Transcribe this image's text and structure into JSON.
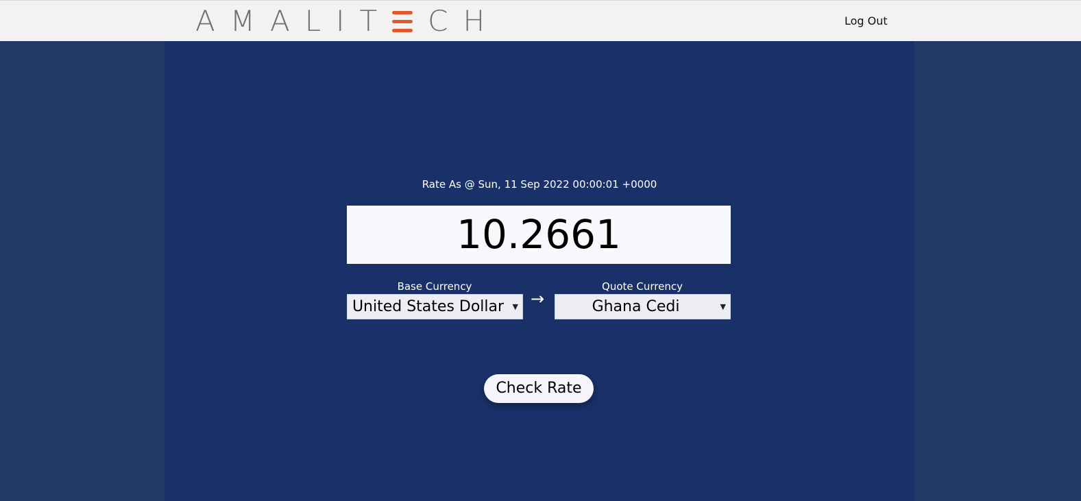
{
  "header": {
    "logo_text_left": "AMALIT",
    "logo_text_right": "CH",
    "logout_label": "Log Out"
  },
  "rate": {
    "as_of_text": "Rate As @ Sun, 11 Sep 2022 00:00:01 +0000",
    "value": "10.2661"
  },
  "base": {
    "label": "Base Currency",
    "selected": "United States Dollar"
  },
  "quote": {
    "label": "Quote Currency",
    "selected": "Ghana Cedi"
  },
  "arrow_icon": "→",
  "check_button_label": "Check Rate",
  "colors": {
    "header_bg": "#f3f2f2",
    "page_bg": "#233a68",
    "panel_bg": "#1a3068",
    "logo_accent": "#e05a2b",
    "logo_gray": "#6d6e71"
  }
}
